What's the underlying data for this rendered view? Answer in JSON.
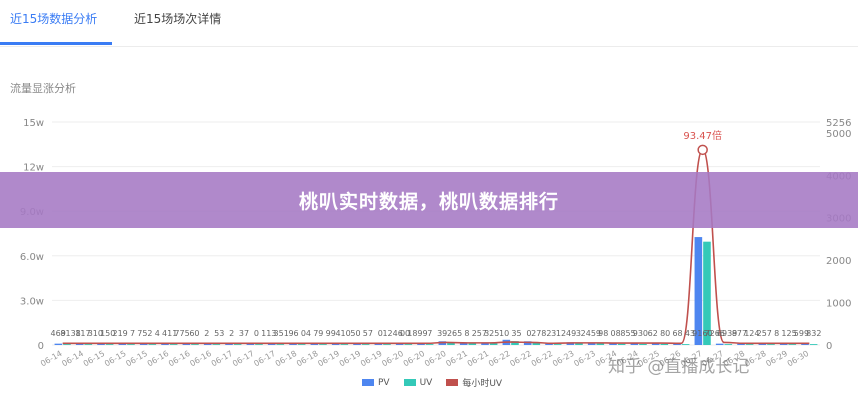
{
  "tabs": [
    {
      "label": "近15场数据分析",
      "active": true
    },
    {
      "label": "近15场场次详情",
      "active": false
    }
  ],
  "section_title": "流量显涨分析",
  "banner": {
    "text": "桃叭实时数据，桃叭数据排行"
  },
  "watermark": "知乎 @直播成长记",
  "colors": {
    "pv": "#4e86f0",
    "uv": "#34c9b8",
    "hourly_uv": "#c0504d",
    "accent": "#3a7cf4",
    "banner": "#a579c4"
  },
  "chart_data": {
    "type": "bar",
    "categories": [
      "06-14",
      "06-14",
      "06-15",
      "06-15",
      "06-15",
      "06-16",
      "06-16",
      "06-16",
      "06-17",
      "06-17",
      "06-17",
      "06-18",
      "06-18",
      "06-19",
      "06-19",
      "06-19",
      "06-20",
      "06-20",
      "06-20",
      "06-21",
      "06-21",
      "06-22",
      "06-22",
      "06-22",
      "06-23",
      "06-23",
      "06-24",
      "06-24",
      "06-25",
      "06-26",
      "06-27",
      "06-27",
      "06-28",
      "06-28",
      "06-29",
      "06-30"
    ],
    "y_left": {
      "ticks": [
        "0",
        "3.0w",
        "6.0w",
        "9.0w",
        "12w",
        "15w"
      ],
      "range": [
        0,
        150000
      ]
    },
    "y_right": {
      "ticks": [
        "0",
        "1000",
        "2000",
        "3000",
        "4000",
        "5000",
        "5256"
      ],
      "range": [
        0,
        5256
      ]
    },
    "series": [
      {
        "name": "PV",
        "axis": "left",
        "values": [
          900,
          900,
          900,
          900,
          900,
          900,
          900,
          900,
          900,
          900,
          900,
          900,
          900,
          900,
          900,
          900,
          900,
          900,
          2500,
          1500,
          1500,
          3500,
          2500,
          900,
          1800,
          1500,
          1200,
          1100,
          1100,
          1000,
          72600,
          900,
          900,
          900,
          900,
          900
        ]
      },
      {
        "name": "UV",
        "axis": "left",
        "values": [
          600,
          600,
          600,
          600,
          600,
          600,
          600,
          600,
          600,
          600,
          600,
          600,
          600,
          600,
          600,
          600,
          600,
          600,
          1800,
          1000,
          1000,
          2600,
          1800,
          600,
          1200,
          1000,
          800,
          700,
          700,
          600,
          69500,
          600,
          600,
          600,
          600,
          600
        ]
      },
      {
        "name": "每小时UV",
        "axis": "right",
        "values": [
          40,
          40,
          40,
          40,
          40,
          40,
          40,
          40,
          40,
          40,
          40,
          40,
          40,
          40,
          40,
          40,
          40,
          40,
          60,
          50,
          50,
          70,
          60,
          40,
          50,
          50,
          45,
          45,
          45,
          40,
          4600,
          60,
          40,
          40,
          40,
          40
        ]
      }
    ],
    "data_labels": [
      "469",
      "8138",
      "117",
      "310",
      "150",
      "219",
      "7",
      "752",
      "4",
      "411",
      "775",
      "60",
      "2",
      "53",
      "2",
      "37",
      "0",
      "113",
      "351",
      "96",
      "04",
      "79",
      "99",
      "410",
      "50",
      "57",
      "0",
      "1246",
      "00",
      "1899",
      "7",
      "39",
      "265",
      "8",
      "257",
      "325",
      "10",
      "35",
      "0",
      "2782",
      "3",
      "1249",
      "3",
      "2459",
      "98",
      "08",
      "855",
      "930",
      "62",
      "80",
      "68",
      "43",
      "9160",
      "7266",
      "6939",
      "877",
      "124",
      "257",
      "8",
      "125",
      "599",
      "832"
    ],
    "peak_label": "93.47倍",
    "legend": [
      {
        "name": "PV"
      },
      {
        "name": "UV"
      },
      {
        "name": "每小时UV"
      }
    ]
  }
}
